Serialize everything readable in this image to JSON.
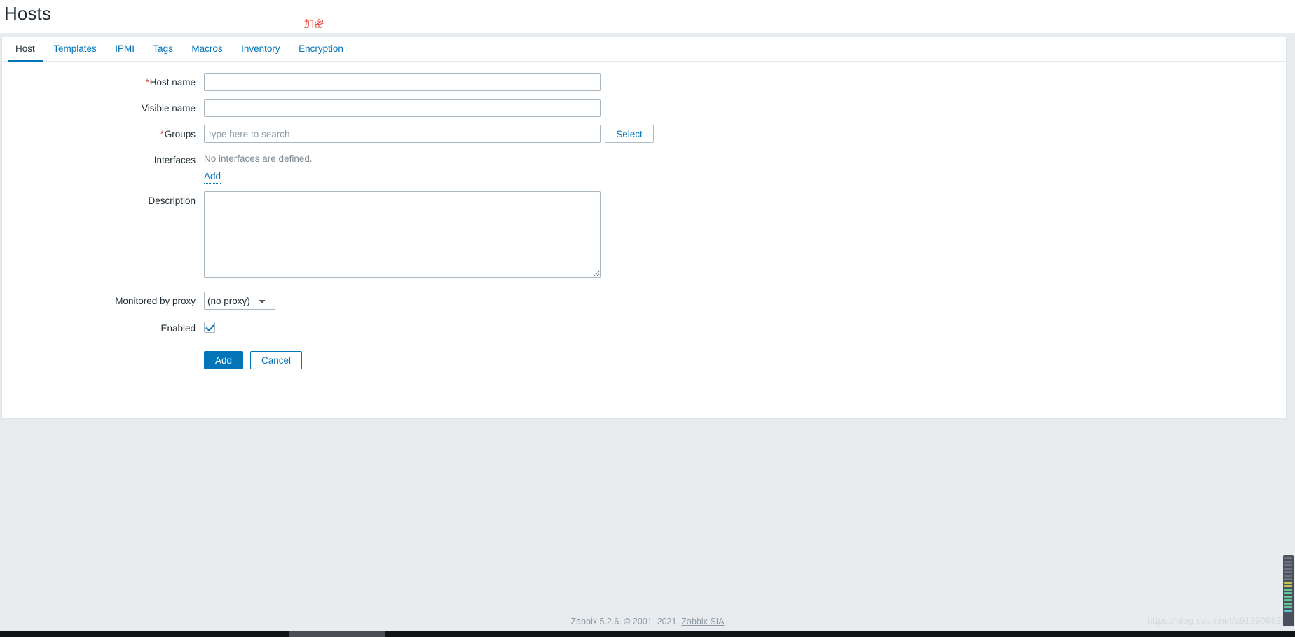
{
  "header": {
    "title": "Hosts",
    "annotation": "加密"
  },
  "tabs": [
    {
      "label": "Host",
      "active": true
    },
    {
      "label": "Templates",
      "active": false
    },
    {
      "label": "IPMI",
      "active": false
    },
    {
      "label": "Tags",
      "active": false
    },
    {
      "label": "Macros",
      "active": false
    },
    {
      "label": "Inventory",
      "active": false
    },
    {
      "label": "Encryption",
      "active": false
    }
  ],
  "form": {
    "host_name": {
      "label": "Host name",
      "required": true,
      "value": "",
      "placeholder": ""
    },
    "visible_name": {
      "label": "Visible name",
      "required": false,
      "value": "",
      "placeholder": ""
    },
    "groups": {
      "label": "Groups",
      "required": true,
      "value": "",
      "placeholder": "type here to search",
      "select_button": "Select"
    },
    "interfaces": {
      "label": "Interfaces",
      "empty_text": "No interfaces are defined.",
      "add_link": "Add"
    },
    "description": {
      "label": "Description",
      "value": "",
      "placeholder": ""
    },
    "monitored_by_proxy": {
      "label": "Monitored by proxy",
      "selected": "(no proxy)",
      "options": [
        "(no proxy)"
      ]
    },
    "enabled": {
      "label": "Enabled",
      "checked": true
    },
    "actions": {
      "submit": "Add",
      "cancel": "Cancel"
    }
  },
  "footer": {
    "text": "Zabbix 5.2.6. © 2001–2021, ",
    "link": "Zabbix SIA"
  },
  "watermark": "https://blog.csdn.net/a913909626",
  "colors": {
    "accent": "#0275b8",
    "required_marker": "#dd4444",
    "annotation": "#e8362c",
    "page_background": "#e8ecef",
    "card_background": "#ffffff",
    "muted_text": "#7e8b94"
  }
}
